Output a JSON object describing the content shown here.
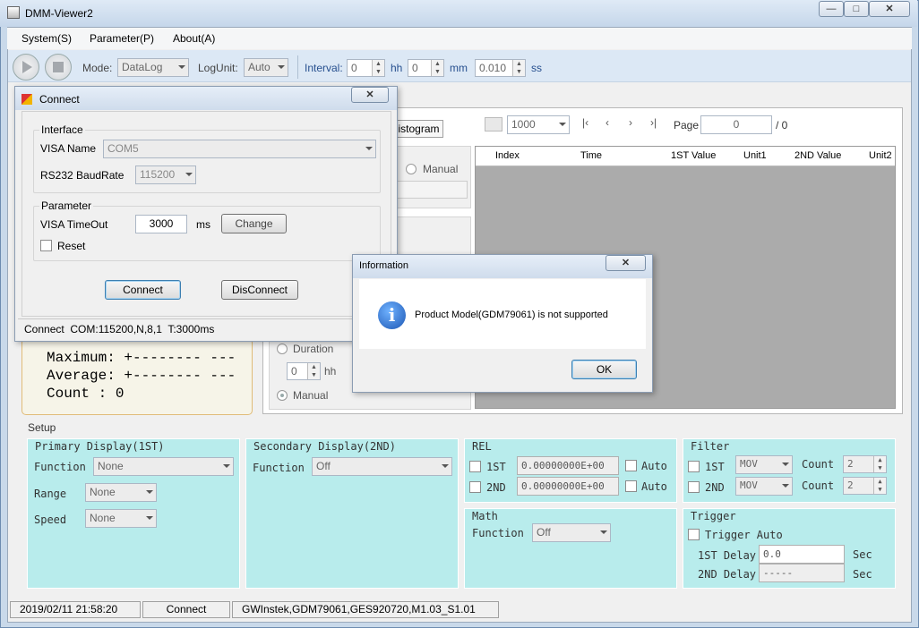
{
  "app": {
    "title": "DMM-Viewer2"
  },
  "menu": [
    "System(S)",
    "Parameter(P)",
    "About(A)"
  ],
  "toolbar": {
    "mode_label": "Mode:",
    "mode_value": "DataLog",
    "logunit_label": "LogUnit:",
    "logunit_value": "Auto",
    "interval_label": "Interval:",
    "hh_value": "0",
    "hh_unit": "hh",
    "mm_value": "0",
    "mm_unit": "mm",
    "ss_value": "0.010",
    "ss_unit": "ss"
  },
  "tabs": {
    "histogram": "istogram"
  },
  "paging": {
    "rows_value": "1000",
    "page_label": "Page",
    "page_value": "0",
    "page_total": "/ 0"
  },
  "table": {
    "columns": [
      "Index",
      "Time",
      "1ST Value",
      "Unit1",
      "2ND Value",
      "Unit2"
    ]
  },
  "mode_panel": {
    "manual_label": "Manual",
    "duration_label": "Duration",
    "duration_value": "0",
    "duration_unit": "hh",
    "manual_label_2": "Manual"
  },
  "stats": {
    "maximum": "Maximum: +-------- ---",
    "average": "Average: +-------- ---",
    "count": "Count  : 0"
  },
  "setup": {
    "title": "Setup",
    "primary": {
      "title": "Primary Display(1ST)",
      "function_label": "Function",
      "function_value": "None",
      "range_label": "Range",
      "range_value": "None",
      "speed_label": "Speed",
      "speed_value": "None"
    },
    "secondary": {
      "title": "Secondary Display(2ND)",
      "function_label": "Function",
      "function_value": "Off"
    },
    "rel": {
      "title": "REL",
      "first_label": "1ST",
      "first_value": "0.00000000E+00",
      "second_label": "2ND",
      "second_value": "0.00000000E+00",
      "auto_label": "Auto"
    },
    "filter": {
      "title": "Filter",
      "first_label": "1ST",
      "first_type": "MOV",
      "second_label": "2ND",
      "second_type": "MOV",
      "count_label": "Count",
      "first_count": "2",
      "second_count": "2"
    },
    "math": {
      "title": "Math",
      "function_label": "Function",
      "function_value": "Off"
    },
    "trigger": {
      "title": "Trigger",
      "auto_label": "Trigger Auto",
      "first_delay_label": "1ST Delay",
      "first_delay_value": "0.0",
      "second_delay_label": "2ND Delay",
      "second_delay_value": "-----",
      "unit": "Sec"
    }
  },
  "status": {
    "datetime": "2019/02/11 21:58:20",
    "connection": "Connect",
    "device": "GWInstek,GDM79061,GES920720,M1.03_S1.01"
  },
  "connect_dialog": {
    "title": "Connect",
    "interface_title": "Interface",
    "visa_name_label": "VISA Name",
    "visa_name_value": "COM5",
    "baud_label": "RS232 BaudRate",
    "baud_value": "115200",
    "parameter_title": "Parameter",
    "timeout_label": "VISA TimeOut",
    "timeout_value": "3000",
    "timeout_unit": "ms",
    "change_button": "Change",
    "reset_label": "Reset",
    "connect_button": "Connect",
    "disconnect_button": "DisConnect",
    "status": "Connect  COM:115200,N,8,1  T:3000ms"
  },
  "info_dialog": {
    "title": "Information",
    "message": "Product Model(GDM79061) is not supported",
    "ok_button": "OK"
  },
  "colors": {
    "setup_group": "#b8ecec",
    "accent": "#27508f"
  }
}
